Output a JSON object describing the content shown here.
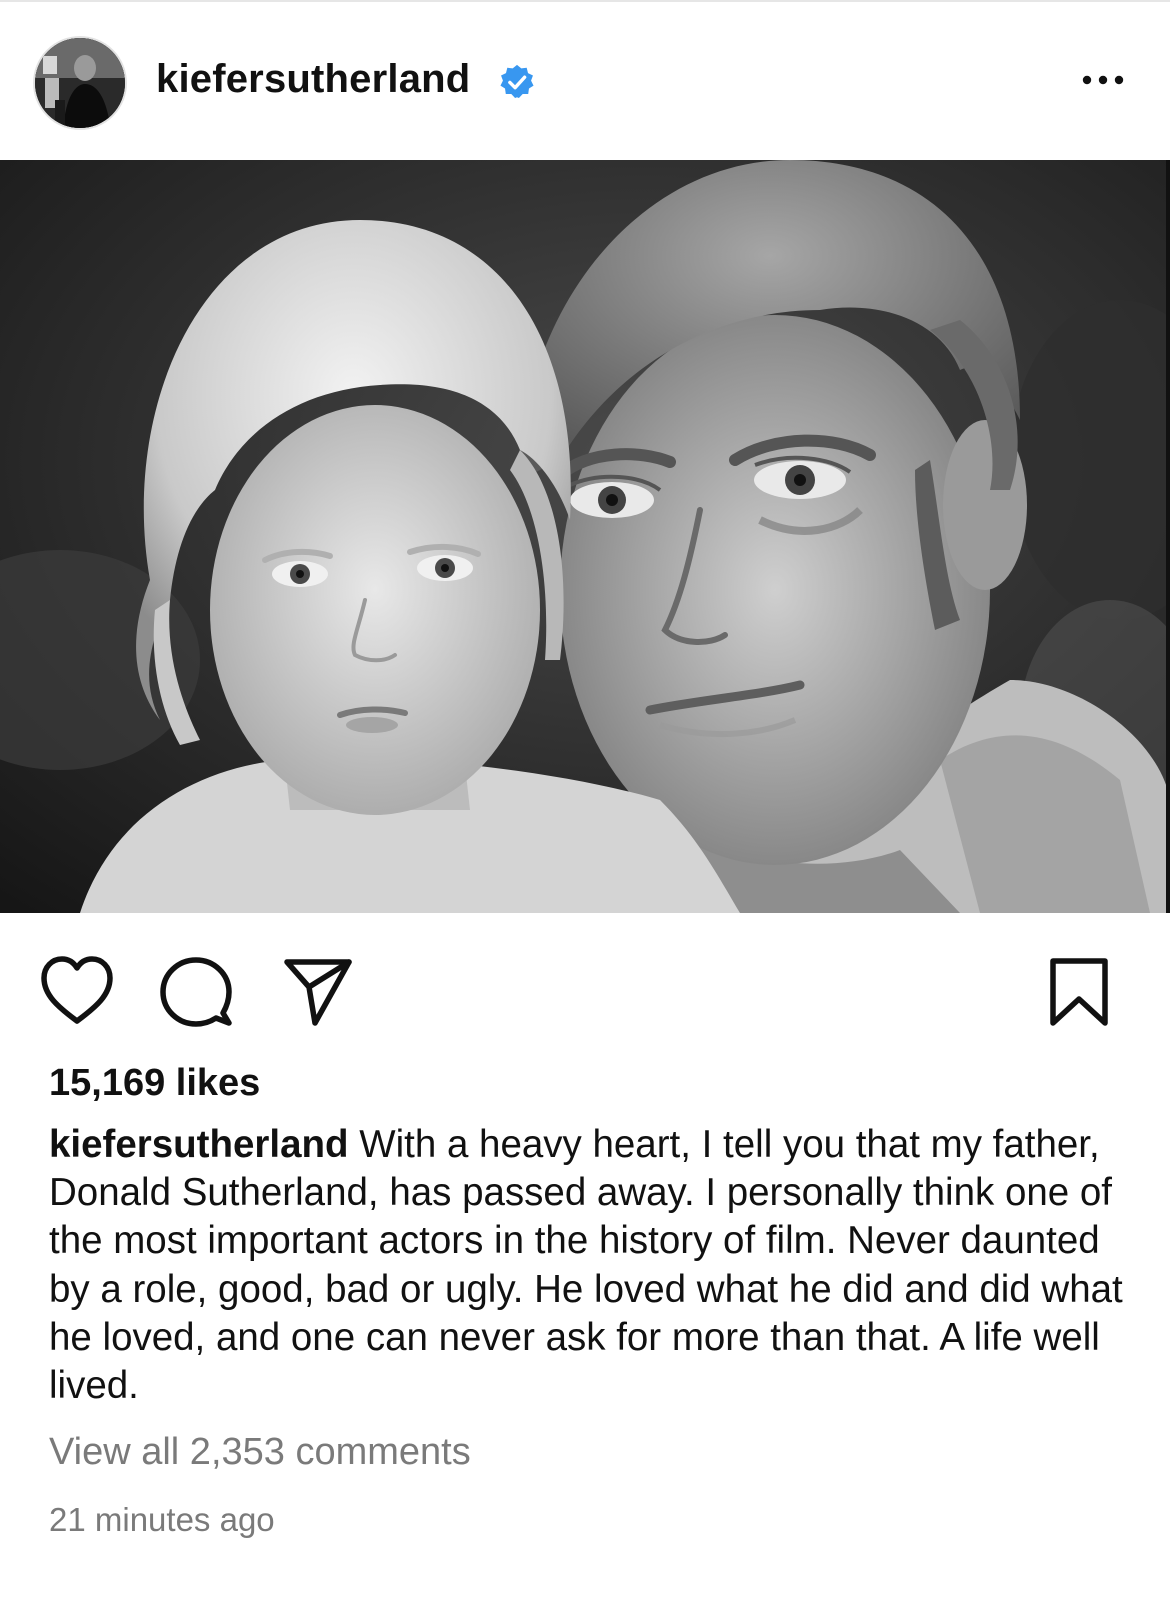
{
  "header": {
    "username": "kiefersutherland",
    "verified": true,
    "verified_icon": "verified-badge-icon",
    "verified_color": "#3897f0",
    "more_icon": "more-options-icon"
  },
  "photo": {
    "alt": "Black and white photo of a young blond child with a man, cheek to cheek"
  },
  "actions": {
    "like_icon": "heart-icon",
    "comment_icon": "comment-icon",
    "share_icon": "send-icon",
    "save_icon": "bookmark-icon"
  },
  "post": {
    "likes": "15,169 likes",
    "caption_user": "kiefersutherland",
    "caption_text": "With a heavy heart, I tell you that my father, Donald Sutherland, has passed away. I personally think one of the most important actors in the history of film. Never daunted by a role, good, bad or ugly. He loved what he did and did what he loved, and one can never ask for more than that. A life well lived.",
    "view_comments": "View all 2,353 comments",
    "timestamp": "21 minutes ago"
  }
}
